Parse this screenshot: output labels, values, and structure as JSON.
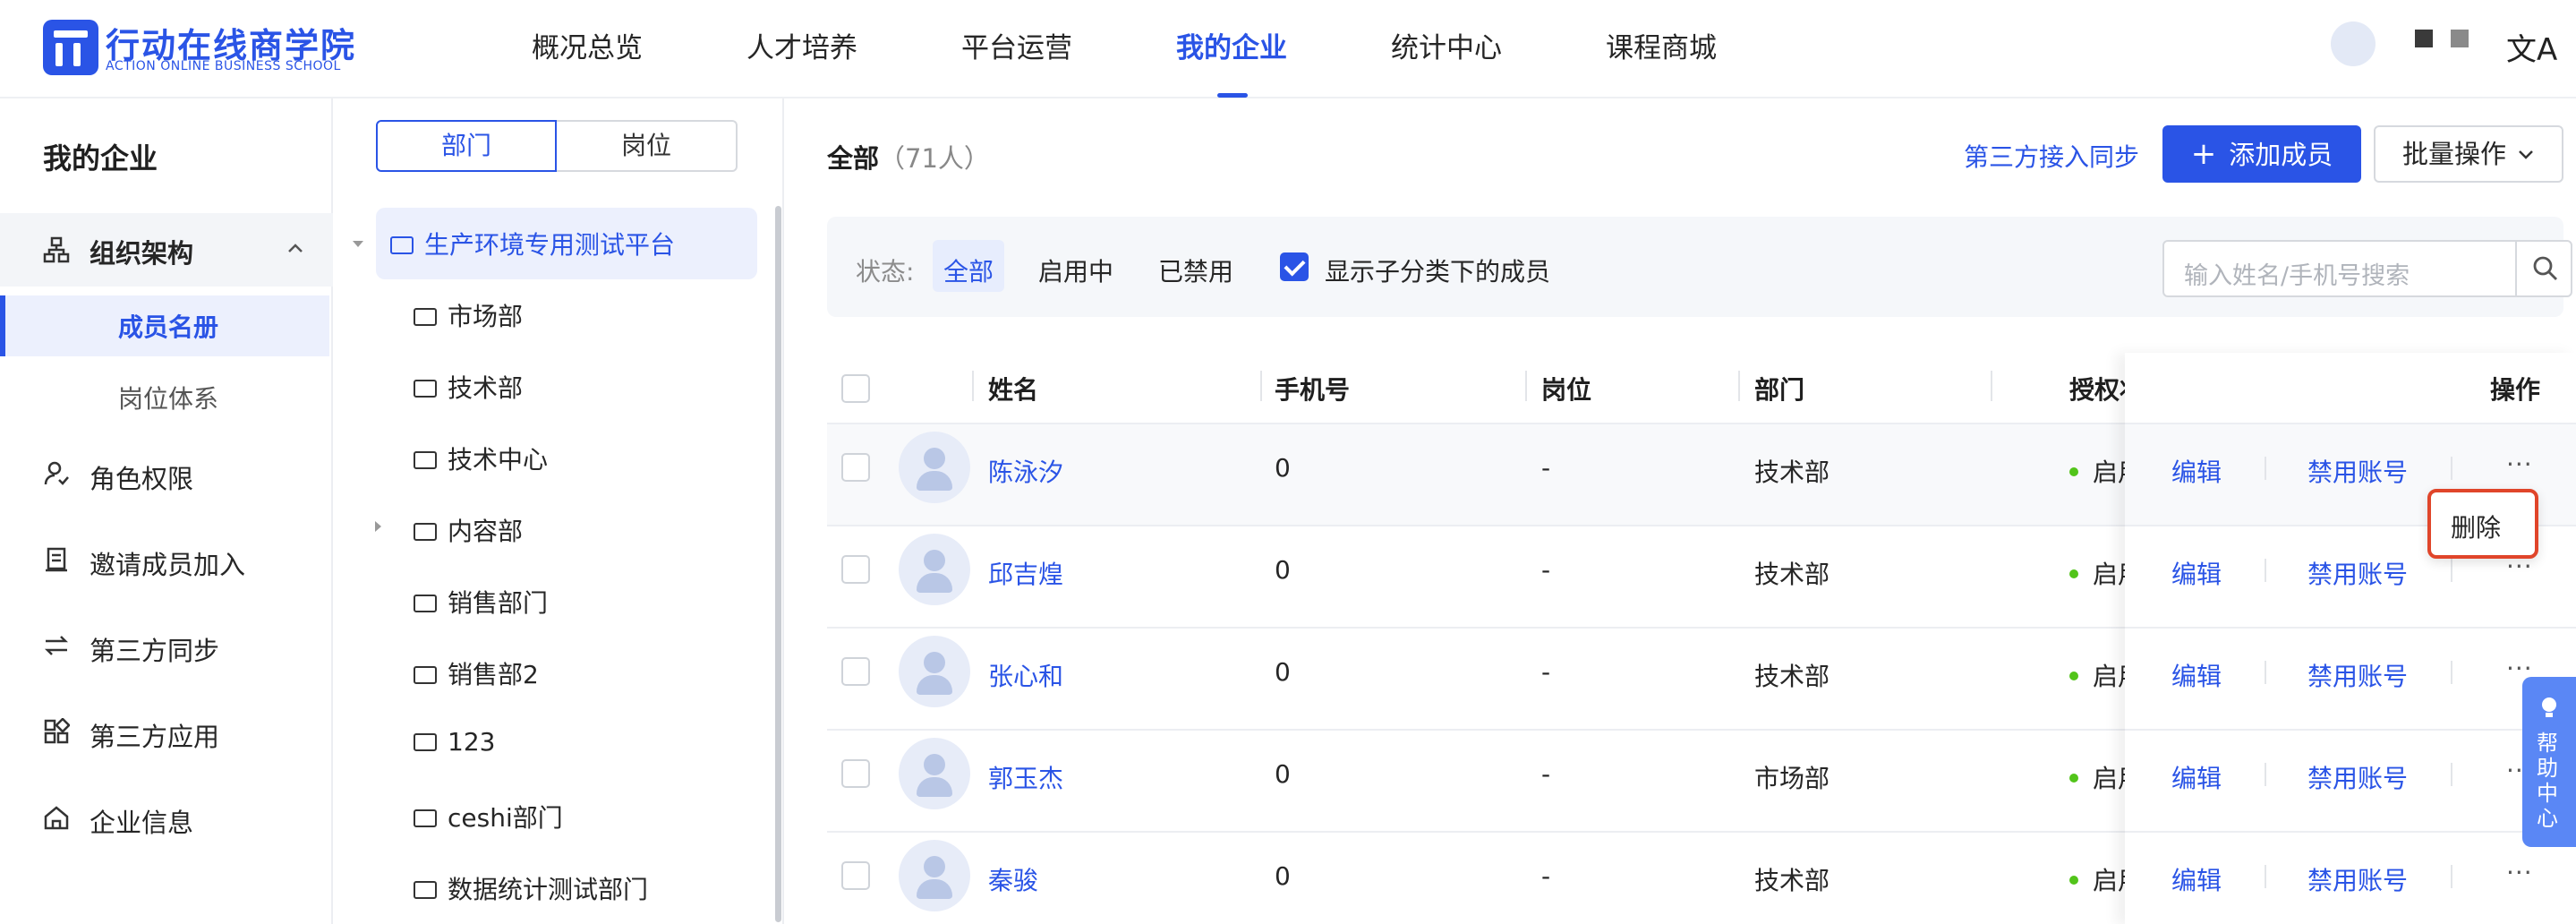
{
  "header": {
    "logo_cn": "行动在线商学院",
    "logo_en": "ACTION ONLINE BUSINESS SCHOOL",
    "nav": [
      {
        "label": "概况总览"
      },
      {
        "label": "人才培养"
      },
      {
        "label": "平台运营"
      },
      {
        "label": "我的企业",
        "active": true
      },
      {
        "label": "统计中心"
      },
      {
        "label": "课程商城"
      }
    ],
    "translate_icon": "文A"
  },
  "sidebar": {
    "title": "我的企业",
    "group": {
      "label": "组织架构",
      "icon": "org-structure-icon",
      "children": [
        {
          "label": "成员名册",
          "active": true
        },
        {
          "label": "岗位体系"
        }
      ]
    },
    "items": [
      {
        "label": "角色权限",
        "icon": "user-role-icon"
      },
      {
        "label": "邀请成员加入",
        "icon": "invite-icon"
      },
      {
        "label": "第三方同步",
        "icon": "sync-icon"
      },
      {
        "label": "第三方应用",
        "icon": "apps-icon"
      },
      {
        "label": "企业信息",
        "icon": "home-icon"
      }
    ]
  },
  "tree": {
    "tabs": [
      "部门",
      "岗位"
    ],
    "root": "生产环境专用测试平台",
    "items": [
      "市场部",
      "技术部",
      "技术中心",
      "内容部",
      "销售部门",
      "销售部2",
      "123",
      "ceshi部门",
      "数据统计测试部门"
    ]
  },
  "main": {
    "title": "全部",
    "count": "（71人）",
    "sync_link": "第三方接入同步",
    "add_button": "添加成员",
    "batch_button": "批量操作",
    "filter": {
      "label": "状态:",
      "options": [
        "全部",
        "启用中",
        "已禁用"
      ],
      "selected": "全部",
      "show_children_label": "显示子分类下的成员",
      "show_children_checked": true
    },
    "search_placeholder": "输入姓名/手机号搜索",
    "columns": [
      "姓名",
      "手机号",
      "岗位",
      "部门",
      "授权状",
      "操作"
    ],
    "rows": [
      {
        "name": "陈泳汐",
        "phone": "0",
        "post": "-",
        "dept": "技术部",
        "status": "启用"
      },
      {
        "name": "邱吉煌",
        "phone": "0",
        "post": "-",
        "dept": "技术部",
        "status": "启用"
      },
      {
        "name": "张心和",
        "phone": "0",
        "post": "-",
        "dept": "技术部",
        "status": "启用"
      },
      {
        "name": "郭玉杰",
        "phone": "0",
        "post": "-",
        "dept": "市场部",
        "status": "启用"
      },
      {
        "name": "秦骏",
        "phone": "0",
        "post": "-",
        "dept": "技术部",
        "status": "启用"
      }
    ],
    "row_actions": {
      "edit": "编辑",
      "disable": "禁用账号",
      "more": "···"
    },
    "popup_delete": "删除"
  },
  "help": {
    "label": "帮助中心"
  },
  "colors": {
    "accent": "#2a54e6",
    "status_green": "#52c41a",
    "highlight_red": "#e0452a"
  }
}
